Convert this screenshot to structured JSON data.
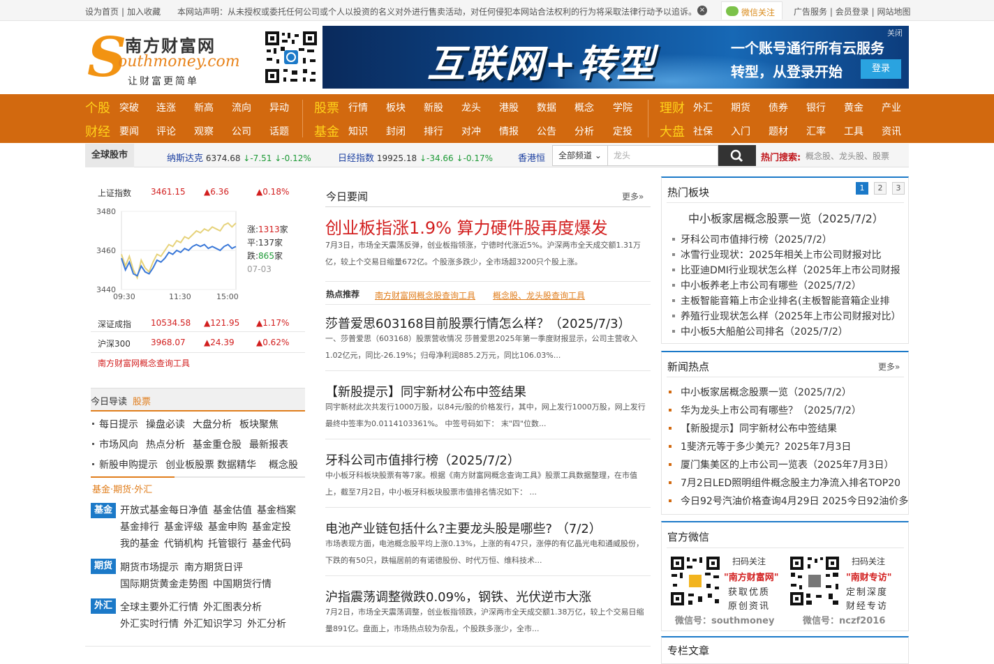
{
  "topbar": {
    "home": "设为首页",
    "sep": "|",
    "fav": "加入收藏",
    "notice": "本网站声明：从未授权或委托任何公司或个人以投资的名义对外进行售卖活动，对任何侵犯本网站合法权利的行为将采取法律行动予以追诉。",
    "close": "×",
    "wechat": "微信关注",
    "ad": "广告服务",
    "login": "会员登录",
    "sitemap": "网站地图"
  },
  "logo": {
    "s": "S",
    "cn": "南方财富网",
    "en": "outhmoney.com",
    "slogan": "让财富更简单"
  },
  "banner": {
    "big": "互联网+转型",
    "line1": "一个账号通行所有云服务",
    "line2": "转型，从登录开始",
    "button": "登录",
    "close": "关闭"
  },
  "nav": {
    "g1": {
      "lead1": "个股",
      "items1": [
        "突破",
        "连涨",
        "新高",
        "流向",
        "异动"
      ],
      "lead2": "财经",
      "items2": [
        "要闻",
        "评论",
        "观察",
        "公司",
        "话题"
      ]
    },
    "g2": {
      "lead1": "股票",
      "items1": [
        "行情",
        "板块",
        "新股",
        "龙头",
        "港股",
        "数据",
        "概念",
        "学院"
      ],
      "lead2": "基金",
      "items2": [
        "知识",
        "封闭",
        "排行",
        "对冲",
        "情报",
        "公告",
        "分析",
        "定投"
      ]
    },
    "g3": {
      "lead1": "理财",
      "items1": [
        "外汇",
        "期货",
        "债券",
        "银行",
        "黄金",
        "产业"
      ],
      "lead2": "大盘",
      "items2": [
        "社保",
        "入门",
        "题材",
        "汇率",
        "工具",
        "资讯"
      ]
    }
  },
  "ticker": {
    "label": "全球股市",
    "quotes": [
      {
        "name": "纳斯达克",
        "value": "6374.68",
        "chg": "↓-7.51",
        "pct": "↓-0.12%"
      },
      {
        "name": "日经指数",
        "value": "19925.18",
        "chg": "↓-34.66",
        "pct": "↓-0.17%"
      },
      {
        "name": "香港恒",
        "value": "",
        "chg": "",
        "pct": ""
      }
    ],
    "channel": "全部频道",
    "search_placeholder": "龙头",
    "hot_label": "热门搜索:",
    "hot_values": "概念股、龙头股、股票"
  },
  "index": {
    "sh": {
      "name": "上证指数",
      "value": "3461.15",
      "chg": "▲6.36",
      "pct": "▲0.18%"
    },
    "sz": {
      "name": "深证成指",
      "value": "10534.58",
      "chg": "▲121.95",
      "pct": "▲1.17%"
    },
    "hs": {
      "name": "沪深300",
      "value": "3968.07",
      "chg": "▲24.39",
      "pct": "▲0.62%"
    },
    "tool": "南方财富网概念查询工具",
    "up_label": "涨:",
    "up": "1313",
    "flat_label": "平:",
    "flat": "137",
    "down_label": "跌:",
    "down": "865",
    "unit": "家",
    "date": "07-03"
  },
  "chart_data": {
    "type": "line",
    "ylim": [
      3440,
      3480
    ],
    "yticks": [
      "3480",
      "3460",
      "3440"
    ],
    "xticks": [
      "09:30",
      "11:30",
      "15:00"
    ],
    "series": [
      {
        "values": [
          3458,
          3452,
          3457,
          3450,
          3446,
          3455,
          3451,
          3449,
          3454,
          3458,
          3457,
          3460,
          3463,
          3462,
          3465,
          3464,
          3467,
          3466,
          3468,
          3470,
          3469,
          3471,
          3470,
          3472,
          3471,
          3470,
          3473,
          3474,
          3472,
          3474
        ],
        "color": "#e6d27a"
      },
      {
        "values": [
          3456,
          3450,
          3454,
          3448,
          3447,
          3452,
          3449,
          3448,
          3451,
          3455,
          3454,
          3456,
          3459,
          3458,
          3460,
          3459,
          3461,
          3460,
          3462,
          3463,
          3462,
          3463,
          3461,
          3462,
          3461,
          3460,
          3462,
          3463,
          3461,
          3462
        ],
        "color": "#3a78d8"
      }
    ]
  },
  "guide": {
    "title": "今日导读",
    "tab": "股票",
    "rows": [
      [
        "每日提示",
        "操盘必读",
        "大盘分析",
        "板块聚焦"
      ],
      [
        "市场风向",
        "热点分析",
        "基金重仓股",
        "最新报表"
      ],
      [
        "新股申购提示",
        "创业板股票",
        "数据精华",
        "概念股"
      ]
    ],
    "sub": "基金·期货·外汇",
    "fund_badge": "基金",
    "fund_rows": [
      [
        "开放式基金每日净值",
        "基金估值",
        "基金档案"
      ],
      [
        "基金排行",
        "基金评级",
        "基金申购",
        "基金定投"
      ],
      [
        "我的基金",
        "代销机构",
        "托管银行",
        "基金代码"
      ]
    ],
    "fut_badge": "期货",
    "fut_rows": [
      [
        "期货市场提示",
        "南方期货日评"
      ],
      [
        "国际期货黄金走势图",
        "中国期货行情"
      ]
    ],
    "fx_badge": "外汇",
    "fx_rows": [
      [
        "全球主要外汇行情",
        "外汇图表分析"
      ],
      [
        "外汇实时行情",
        "外汇知识学习",
        "外汇分析"
      ]
    ]
  },
  "main": {
    "title": "今日要闻",
    "more": "更多»",
    "headline": "创业板指涨1.9% 算力硬件股再度爆发",
    "headline_desc": "7月3日，市场全天震荡反弹，创业板指领涨，宁德时代涨近5%。沪深两市全天成交额1.31万亿，较上个交易日缩量672亿。个股涨多跌少，全市场超3200只个股上涨。",
    "hot_label": "热点推荐",
    "hot1": "南方财富网概念股查询工具",
    "hot2": "概念股、龙头股查询工具",
    "articles": [
      {
        "title": "莎普爱思603168目前股票行情怎么样？（2025/7/3）",
        "desc": "一、莎普爱思（603168）股票营收情况 莎普爱思2025年第一季度财报显示，公司主营收入1.02亿元，同比-26.19%；归母净利润885.2万元，同比106.03%..."
      },
      {
        "title": "【新股提示】同宇新材公布中签结果",
        "desc": "同宇新材此次共发行1000万股，以84元/股的价格发行，其中，网上发行1000万股，网上发行最终中签率为0.0114103361%。 中签号码如下： 末\"四\"位数..."
      },
      {
        "title": "牙科公司市值排行榜（2025/7/2）",
        "desc": "中小板牙科板块股票有等7家。根据《南方财富网概念查询工具》股票工具数据整理，在市值上，截至7月2日，中小板牙科板块股票市值排名情况如下： ..."
      },
      {
        "title": "电池产业链包括什么?主要龙头股是哪些? （7/2）",
        "desc": "市场表现方面，电池概念股平均上涨0.13%，上涨的有47只，涨停的有亿晶光电和通威股份，下跌的有50只，跌幅居前的有诺德股份、时代万恒、维科技术..."
      },
      {
        "title": "沪指震荡调整微跌0.09%，钢铁、光伏逆市大涨",
        "desc": "7月2日，市场全天震荡调整，创业板指领跌，沪深两市全天成交额1.38万亿，较上个交易日缩量891亿。盘面上，市场热点较为杂乱，个股跌多涨少，全市..."
      }
    ]
  },
  "hotblock": {
    "title": "热门板块",
    "pages": [
      "1",
      "2",
      "3"
    ],
    "lead": "中小板家居概念股票一览（2025/7/2）",
    "items": [
      "牙科公司市值排行榜（2025/7/2）",
      "冰雪行业现状：2025年相关上市公司财报对比",
      "比亚迪DMI行业现状怎么样（2025年上市公司财报",
      "中小板养老上市公司有哪些（2025/7/2）",
      "主板智能音箱上市企业排名(主板智能音箱企业排",
      "养殖行业现状怎么样（2025年上市公司财报对比）",
      "中小板5大船舶公司排名（2025/7/2）"
    ]
  },
  "newshot": {
    "title": "新闻热点",
    "more": "更多»",
    "items": [
      "中小板家居概念股票一览（2025/7/2）",
      "华为龙头上市公司有哪些？（2025/7/2）",
      "【新股提示】同宇新材公布中签结果",
      "1斐济元等于多少美元？2025年7月3日",
      "厦门集美区的上市公司一览表（2025年7月3日）",
      "7月2日LED照明组件概念股主力净流入排名TOP20",
      "今日92号汽油价格查询4月29日 2025今日92油价多"
    ]
  },
  "wechat": {
    "title": "官方微信",
    "a": {
      "scan": "扫码关注",
      "name": "\"南方财富网\"",
      "l1": "获取优质",
      "l2": "原创资讯",
      "id": "微信号：southmoney"
    },
    "b": {
      "scan": "扫码关注",
      "name": "\"南财专访\"",
      "l1": "定制深度",
      "l2": "财经专访",
      "id": "微信号：nczf2016"
    }
  },
  "column": {
    "title": "专栏文章"
  }
}
